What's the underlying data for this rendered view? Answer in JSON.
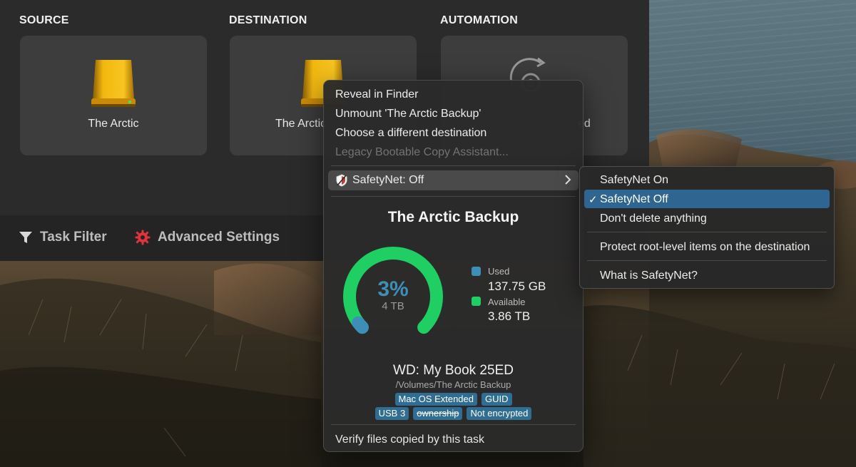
{
  "window": {
    "sections": {
      "source": {
        "heading": "SOURCE",
        "volume": "The Arctic"
      },
      "destination": {
        "heading": "DESTINATION",
        "volume": "The Arctic"
      },
      "automation": {
        "heading": "AUTOMATION",
        "label": "ed"
      }
    },
    "toolbar": {
      "task_filter": "Task Filter",
      "advanced_settings": "Advanced Settings"
    }
  },
  "popover": {
    "menu": [
      {
        "label": "Reveal in Finder",
        "enabled": true
      },
      {
        "label": "Unmount 'The Arctic Backup'",
        "enabled": true
      },
      {
        "label": "Choose a different destination",
        "enabled": true
      },
      {
        "label": "Legacy Bootable Copy Assistant...",
        "enabled": false
      }
    ],
    "safetynet_label": "SafetyNet: Off",
    "volume_title": "The Arctic Backup",
    "usage": {
      "percent_text": "3%",
      "percent": 3,
      "capacity": "4 TB",
      "used_label": "Used",
      "used_value": "137.75 GB",
      "available_label": "Available",
      "available_value": "3.86 TB"
    },
    "drive": {
      "name": "WD: My Book 25ED",
      "path": "/Volumes/The Arctic Backup",
      "badges_row1": [
        "Mac OS Extended",
        "GUID"
      ],
      "badges_row2": [
        "USB 3",
        "ownership",
        "Not encrypted"
      ]
    },
    "verify_label": "Verify files copied by this task"
  },
  "submenu": {
    "items": [
      "SafetyNet On",
      "SafetyNet Off",
      "Don't delete anything",
      "Protect root-level items on the destination",
      "What is SafetyNet?"
    ],
    "checkmark": "✓"
  },
  "colors": {
    "used": "#3d8fb8",
    "available": "#1fcf63",
    "selection": "#2e6691",
    "badge": "#2f6e92",
    "drive_gold": "#e9a90c",
    "gear_red": "#e0333b"
  },
  "icons": {
    "drive": "external-drive-icon",
    "automation": "automation-gear-icon",
    "filter": "funnel-icon",
    "settings": "gear-icon",
    "safetynet": "shield-icon",
    "submenu": "chevron-right-icon"
  }
}
